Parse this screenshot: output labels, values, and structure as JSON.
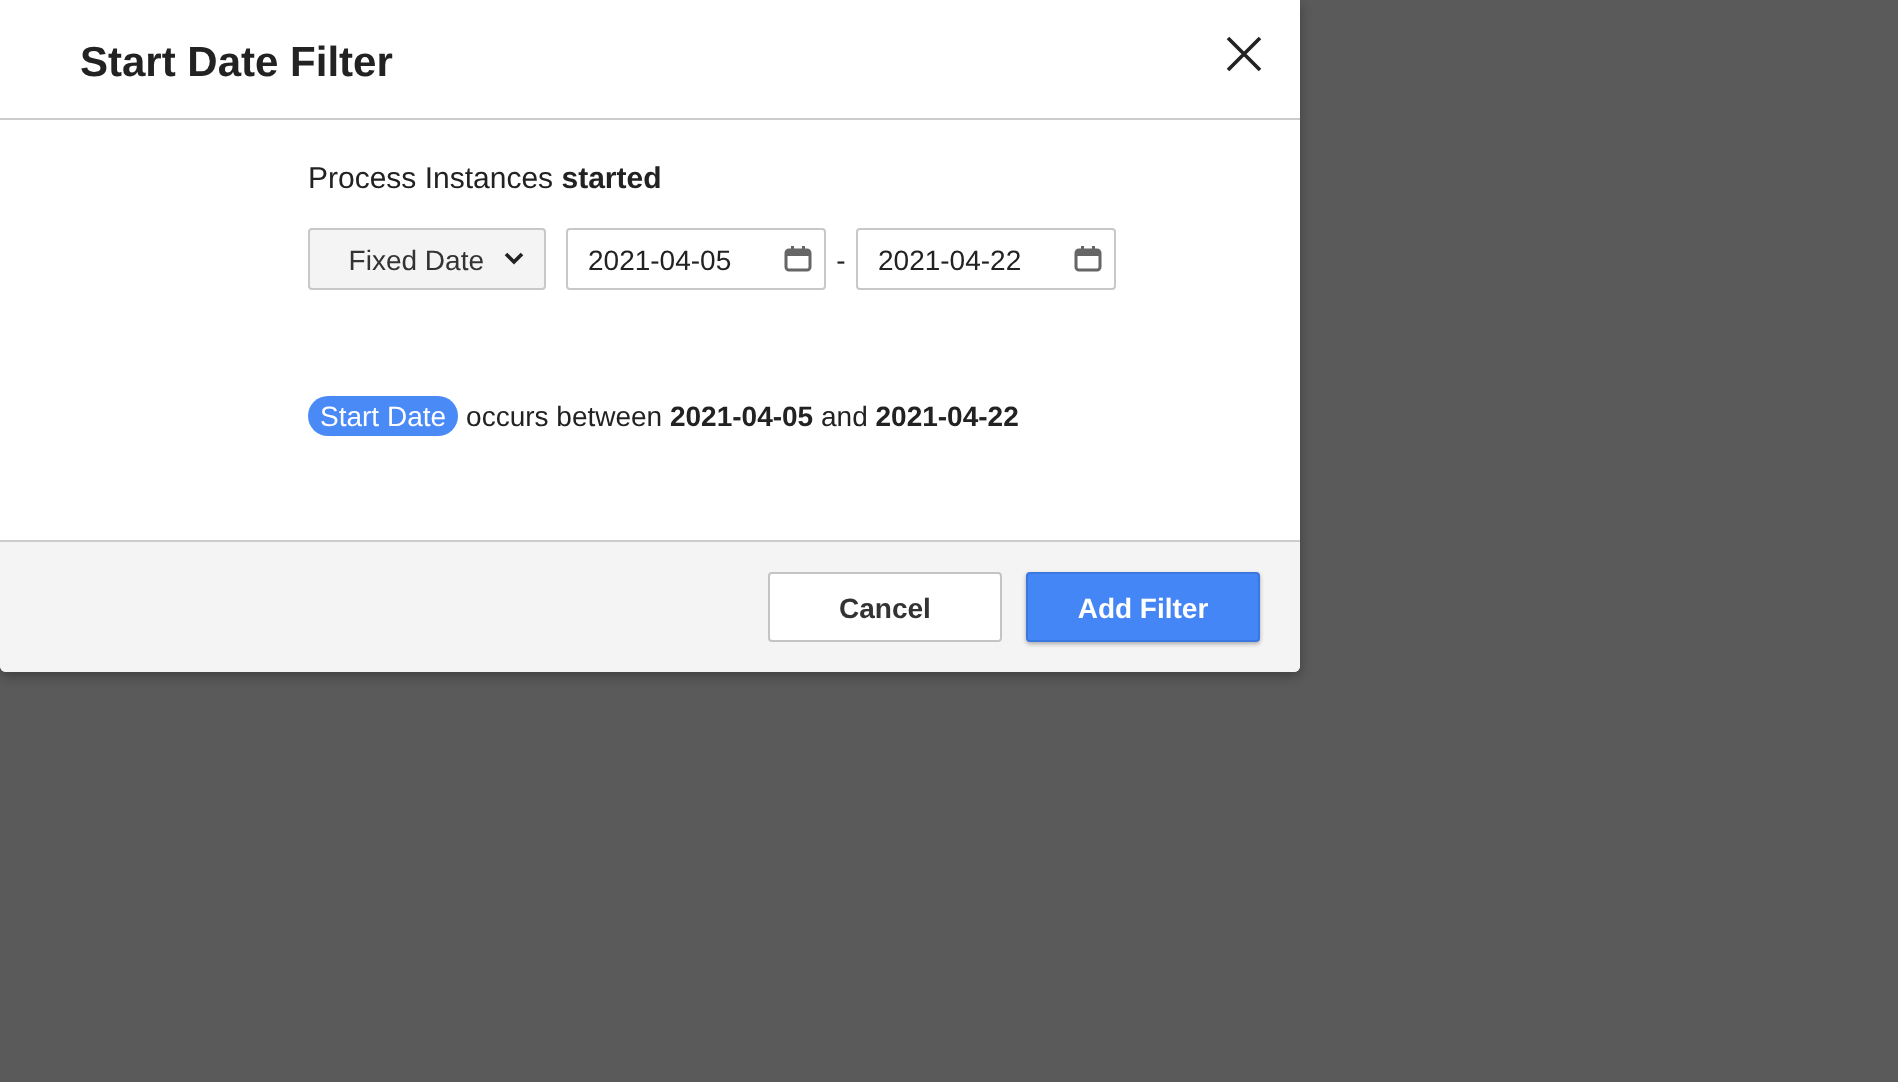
{
  "dialog": {
    "title": "Start Date Filter"
  },
  "heading": "Process Instances **started**",
  "date_type": {
    "value": "Fixed Date"
  },
  "start_date": {
    "value": "2021-04-05"
  },
  "separator": "-",
  "end_date": {
    "value": "2021-04-22"
  },
  "summary": {
    "tag": "Start Date",
    "text": "occurs between **2021-04-05** and **2021-04-22**"
  },
  "buttons": [
    {
      "label": "Cancel",
      "kind": "secondary"
    },
    {
      "label": "Add Filter",
      "kind": "primary"
    }
  ]
}
